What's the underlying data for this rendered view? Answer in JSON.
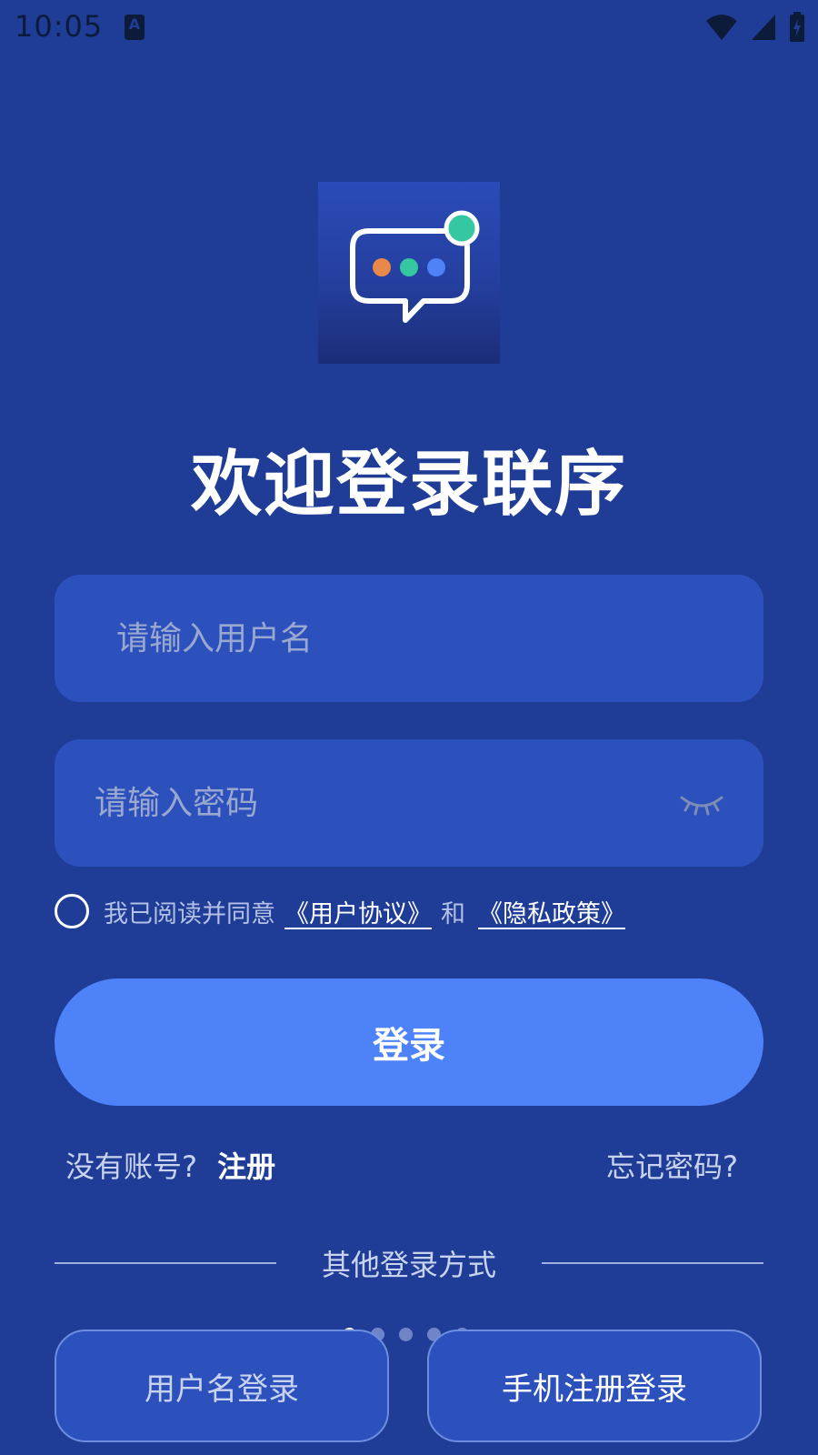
{
  "status_bar": {
    "time": "10:05",
    "notification_icon": "keyboard-a-icon",
    "icons": [
      "wifi-icon",
      "cell-signal-icon",
      "battery-charging-icon"
    ]
  },
  "logo": {
    "icon": "chat-bubble-icon",
    "dot_colors": [
      "#e8894a",
      "#35c8a0",
      "#4d82f8"
    ],
    "badge_color": "#35c8a0"
  },
  "title": "欢迎登录联序",
  "username_field": {
    "placeholder": "请输入用户名",
    "value": ""
  },
  "password_field": {
    "placeholder": "请输入密码",
    "value": "",
    "toggle_icon": "eye-closed-icon"
  },
  "agreement": {
    "prefix": "我已阅读并同意",
    "user_agreement": "《用户协议》",
    "and": "和",
    "privacy_policy": "《隐私政策》",
    "checked": false
  },
  "login_button": "登录",
  "register": {
    "prompt": "没有账号?",
    "link": "注册"
  },
  "forgot_password": "忘记密码?",
  "other_methods": {
    "label": "其他登录方式",
    "page_count": 5,
    "active_page": 1,
    "buttons": [
      "用户名登录",
      "手机注册登录"
    ]
  },
  "colors": {
    "background": "#1f3d96",
    "input": "#2c51bd",
    "primary": "#4d82f8"
  }
}
